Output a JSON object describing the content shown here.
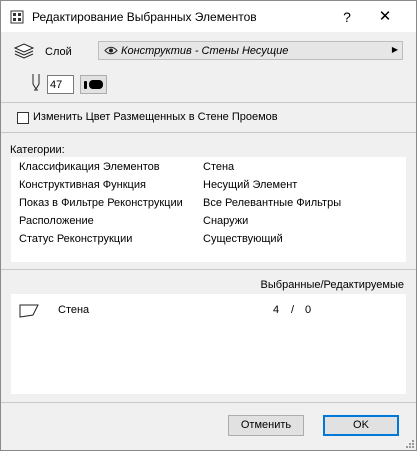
{
  "window": {
    "title": "Редактирование Выбранных Элементов"
  },
  "titlebar": {
    "help_label": "?",
    "close_label": "✕"
  },
  "layer": {
    "label": "Слой",
    "value": "Конструктив - Стены Несущие"
  },
  "pen": {
    "value": "47"
  },
  "checkbox": {
    "label": "Изменить Цвет Размещенных в Стене Проемов",
    "checked": false
  },
  "categories": {
    "heading": "Категории:",
    "rows": [
      {
        "name": "Классификация Элементов",
        "value": "Стена"
      },
      {
        "name": "Конструктивная Функция",
        "value": "Несущий Элемент"
      },
      {
        "name": "Показ в Фильтре Реконструкции",
        "value": "Все Релевантные Фильтры"
      },
      {
        "name": "Расположение",
        "value": "Снаружи"
      },
      {
        "name": "Статус Реконструкции",
        "value": "Существующий"
      }
    ]
  },
  "selection": {
    "heading": "Выбранные/Редактируемые",
    "items": [
      {
        "name": "Стена",
        "selected": "4",
        "separator": "/",
        "editable": "0"
      }
    ]
  },
  "buttons": {
    "cancel": "Отменить",
    "ok": "OK"
  },
  "icons": [
    "app-icon",
    "layer-icon",
    "eye-icon",
    "pen-icon",
    "wall-icon",
    "resize-grip-icon"
  ]
}
